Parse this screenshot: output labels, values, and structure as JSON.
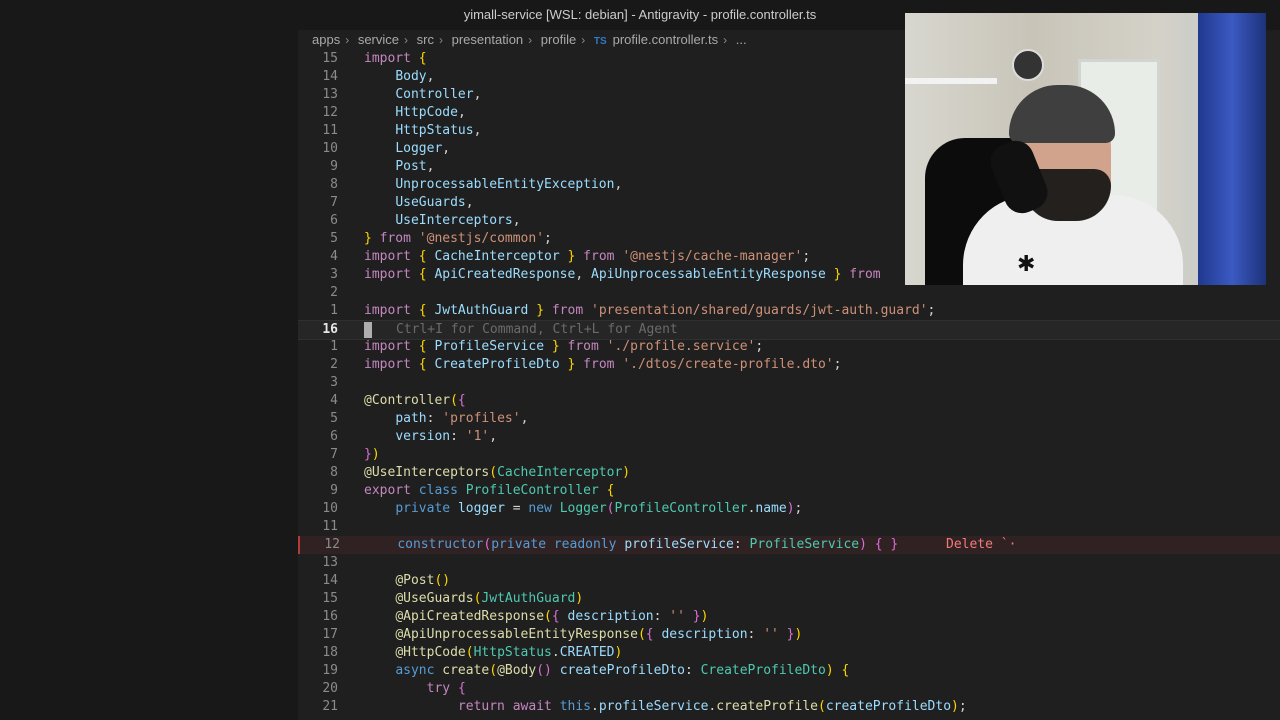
{
  "window": {
    "title": "yimall-service [WSL: debian] - Antigravity - profile.controller.ts"
  },
  "breadcrumb": {
    "items": [
      "apps",
      "service",
      "src",
      "presentation",
      "profile"
    ],
    "file_icon": "TS",
    "file": "profile.controller.ts",
    "more": "..."
  },
  "code": {
    "lines": [
      {
        "n": "15",
        "text": "import {"
      },
      {
        "n": "14",
        "text": "    Body,"
      },
      {
        "n": "13",
        "text": "    Controller,"
      },
      {
        "n": "12",
        "text": "    HttpCode,"
      },
      {
        "n": "11",
        "text": "    HttpStatus,"
      },
      {
        "n": "10",
        "text": "    Logger,"
      },
      {
        "n": "9",
        "text": "    Post,"
      },
      {
        "n": "8",
        "text": "    UnprocessableEntityException,"
      },
      {
        "n": "7",
        "text": "    UseGuards,"
      },
      {
        "n": "6",
        "text": "    UseInterceptors,"
      },
      {
        "n": "5",
        "text": "} from '@nestjs/common';"
      },
      {
        "n": "4",
        "text": "import { CacheInterceptor } from '@nestjs/cache-manager';"
      },
      {
        "n": "3",
        "text": "import { ApiCreatedResponse, ApiUnprocessableEntityResponse } from"
      },
      {
        "n": "2",
        "text": ""
      },
      {
        "n": "1",
        "text": "import { JwtAuthGuard } from 'presentation/shared/guards/jwt-auth.guard';"
      },
      {
        "n": "16",
        "text": ""
      },
      {
        "n": "1",
        "text": "import { ProfileService } from './profile.service';"
      },
      {
        "n": "2",
        "text": "import { CreateProfileDto } from './dtos/create-profile.dto';"
      },
      {
        "n": "3",
        "text": ""
      },
      {
        "n": "4",
        "text": "@Controller({"
      },
      {
        "n": "5",
        "text": "    path: 'profiles',"
      },
      {
        "n": "6",
        "text": "    version: '1',"
      },
      {
        "n": "7",
        "text": "})"
      },
      {
        "n": "8",
        "text": "@UseInterceptors(CacheInterceptor)"
      },
      {
        "n": "9",
        "text": "export class ProfileController {"
      },
      {
        "n": "10",
        "text": "    private logger = new Logger(ProfileController.name);"
      },
      {
        "n": "11",
        "text": ""
      },
      {
        "n": "12",
        "text": "    constructor(private readonly profileService: ProfileService) { }"
      },
      {
        "n": "13",
        "text": ""
      },
      {
        "n": "14",
        "text": "    @Post()"
      },
      {
        "n": "15",
        "text": "    @UseGuards(JwtAuthGuard)"
      },
      {
        "n": "16",
        "text": "    @ApiCreatedResponse({ description: '' })"
      },
      {
        "n": "17",
        "text": "    @ApiUnprocessableEntityResponse({ description: '' })"
      },
      {
        "n": "18",
        "text": "    @HttpCode(HttpStatus.CREATED)"
      },
      {
        "n": "19",
        "text": "    async create(@Body() createProfileDto: CreateProfileDto) {"
      },
      {
        "n": "20",
        "text": "        try {"
      },
      {
        "n": "21",
        "text": "            return await this.profileService.createProfile(createProfileDto);"
      }
    ],
    "inline_hint": "Ctrl+I for Command, Ctrl+L for Agent",
    "delete_hint": "Delete `·"
  },
  "colors": {
    "background": "#1f1f1f",
    "keyword": "#c586c0",
    "string": "#ce9178",
    "type": "#4ec9b0",
    "function": "#dcdcaa"
  }
}
